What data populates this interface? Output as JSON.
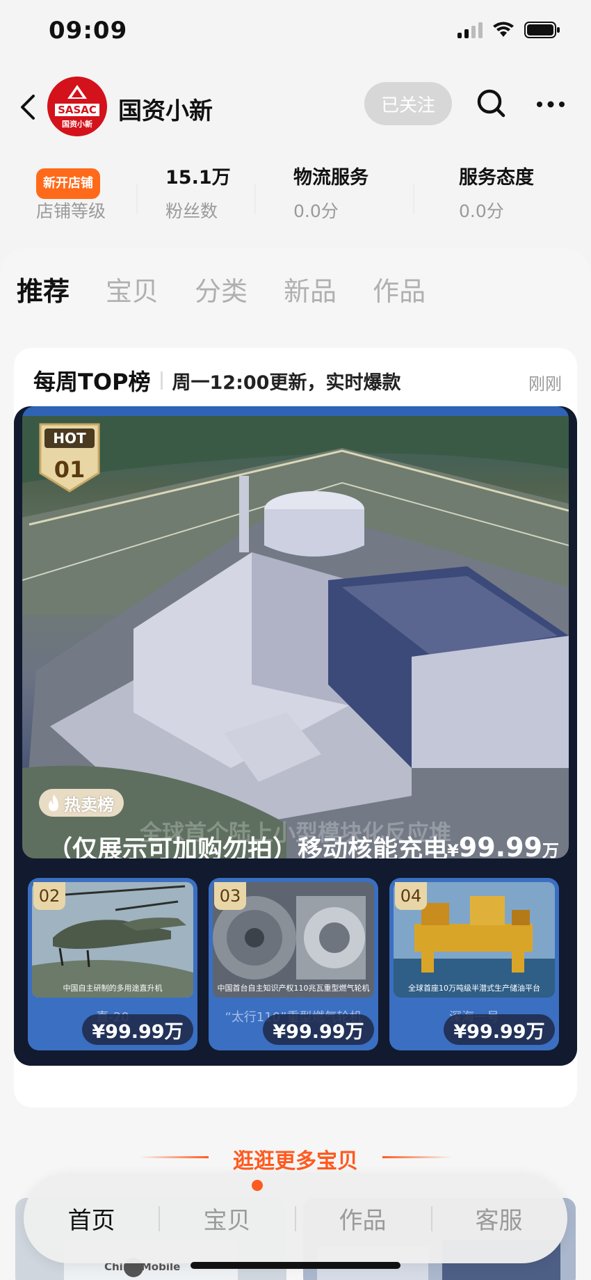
{
  "status_bar": {
    "time": "09:09"
  },
  "header": {
    "shop_name": "国资小新",
    "logo_text_top": "SASAC",
    "logo_text_bottom": "国资小新",
    "follow_label": "已关注"
  },
  "stats": {
    "level_badge": "新开店铺",
    "level_label": "店铺等级",
    "fans_value": "15.1万",
    "fans_label": "粉丝数",
    "logistics_label": "物流服务",
    "logistics_value": "0.0分",
    "service_label": "服务态度",
    "service_value": "0.0分"
  },
  "tabs": [
    "推荐",
    "宝贝",
    "分类",
    "新品",
    "作品"
  ],
  "top_list": {
    "title": "每周TOP榜",
    "subtitle": "周一12:00更新，实时爆款",
    "updated": "刚刚",
    "hero": {
      "hot_label": "HOT",
      "rank": "01",
      "tag": "热卖榜",
      "caption": "全球首个陆上小型模块化反应堆",
      "title": "（仅展示可加购勿拍）移动核能充电",
      "price_currency": "¥",
      "price_value": "99.99",
      "price_unit": "万"
    },
    "items": [
      {
        "rank": "02",
        "desc": "中国自主研制的多用途直升机",
        "name": "直-20",
        "price": "¥99.99万"
      },
      {
        "rank": "03",
        "desc": "中国首台自主知识产权110兆瓦重型燃气轮机",
        "name": "“太行110”重型燃气轮机",
        "price": "¥99.99万"
      },
      {
        "rank": "04",
        "desc": "全球首座10万吨级半潜式生产储油平台",
        "name": "深海一号",
        "price": "¥99.99万"
      }
    ]
  },
  "more_title": "逛逛更多宝贝",
  "bottom_nav": [
    "首页",
    "宝贝",
    "作品",
    "客服"
  ],
  "peek_text": "China Mobile",
  "colors": {
    "accent": "#ff5a1f",
    "brand_red": "#d3121b",
    "board_blue": "#3a6fc2"
  }
}
